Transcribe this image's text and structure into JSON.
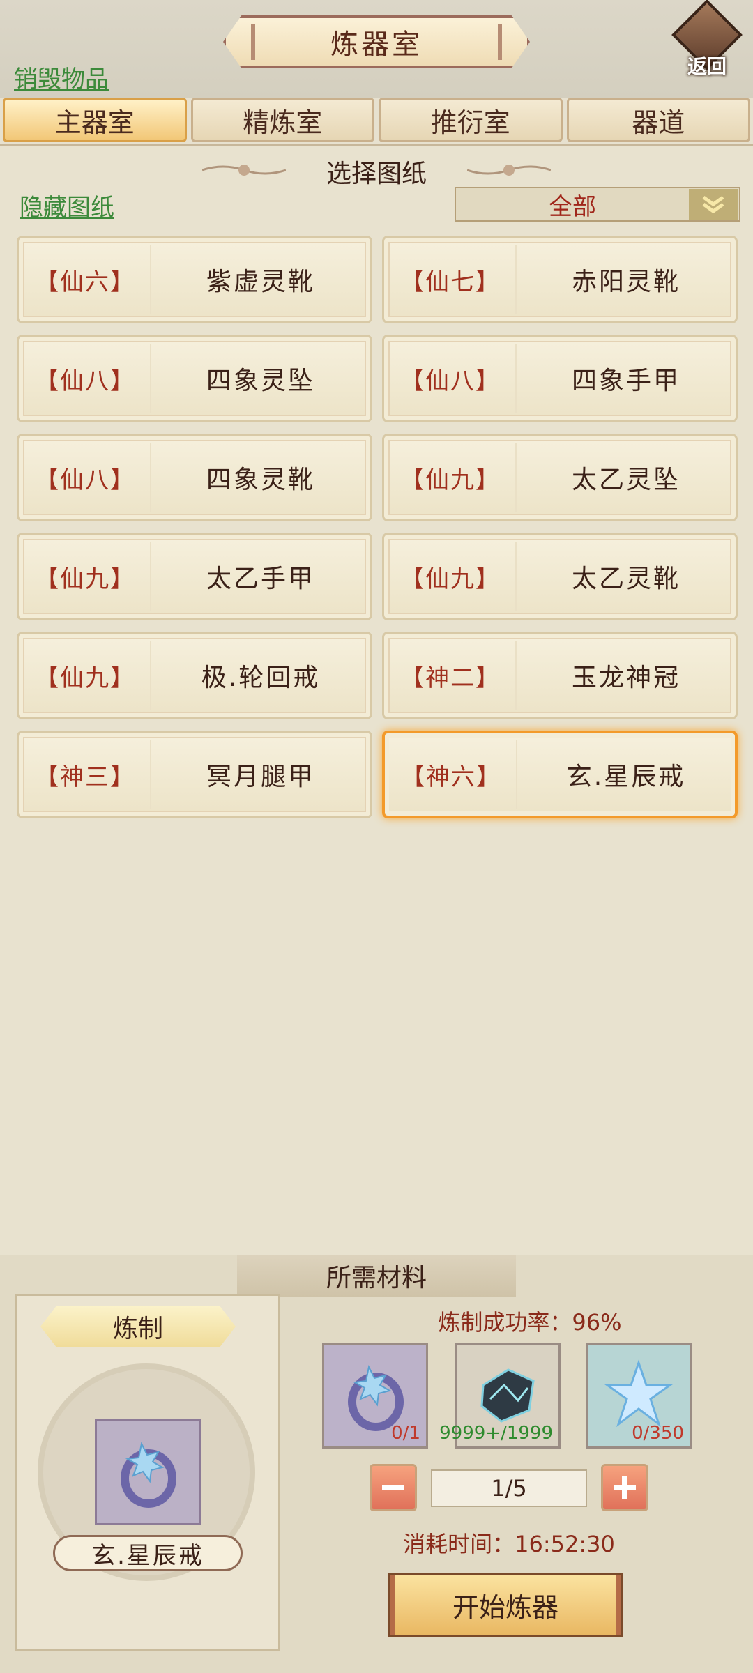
{
  "header": {
    "title": "炼器室",
    "back_label": "返回",
    "destroy_link": "销毁物品"
  },
  "tabs": [
    "主器室",
    "精炼室",
    "推衍室",
    "器道"
  ],
  "active_tab": 0,
  "select_section": {
    "title": "选择图纸",
    "hide_link": "隐藏图纸",
    "filter_value": "全部"
  },
  "blueprints": [
    {
      "grade": "【仙六】",
      "name": "紫虚灵靴"
    },
    {
      "grade": "【仙七】",
      "name": "赤阳灵靴"
    },
    {
      "grade": "【仙八】",
      "name": "四象灵坠"
    },
    {
      "grade": "【仙八】",
      "name": "四象手甲"
    },
    {
      "grade": "【仙八】",
      "name": "四象灵靴"
    },
    {
      "grade": "【仙九】",
      "name": "太乙灵坠"
    },
    {
      "grade": "【仙九】",
      "name": "太乙手甲"
    },
    {
      "grade": "【仙九】",
      "name": "太乙灵靴"
    },
    {
      "grade": "【仙九】",
      "name": "极.轮回戒"
    },
    {
      "grade": "【神二】",
      "name": "玉龙神冠"
    },
    {
      "grade": "【神三】",
      "name": "冥月腿甲"
    },
    {
      "grade": "【神六】",
      "name": "玄.星辰戒"
    }
  ],
  "selected_index": 11,
  "materials_section": {
    "title": "所需材料",
    "craft_label": "炼制",
    "crafted_item_name": "玄.星辰戒",
    "success_rate": "炼制成功率：96%",
    "materials": [
      {
        "icon": "ring-icon",
        "count": "0/1",
        "count_color": "#c0392b",
        "bg": "#bcb2c9"
      },
      {
        "icon": "ore-icon",
        "count": "9999+/1999",
        "count_color": "#2e8b2e",
        "bg": "#d9d2c2"
      },
      {
        "icon": "crystal-icon",
        "count": "0/350",
        "count_color": "#c0392b",
        "bg": "#b7d5d4"
      }
    ],
    "quantity": "1/5",
    "time_cost": "消耗时间：16:52:30",
    "start_button": "开始炼器"
  }
}
